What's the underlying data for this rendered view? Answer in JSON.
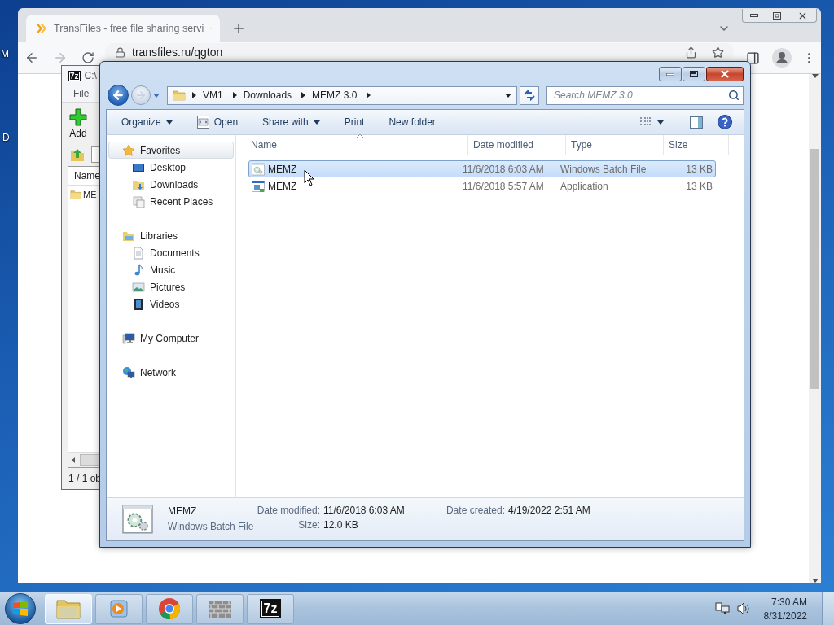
{
  "desktop": {
    "icon_labels": [
      "M",
      "D"
    ]
  },
  "browser": {
    "tab": {
      "title": "TransFiles - free file sharing servi",
      "selected": true
    },
    "address": "transfiles.ru/qgton"
  },
  "archiver": {
    "logo": "7z",
    "title": "C:\\",
    "menu": [
      "File"
    ],
    "toolbar": [
      "Add"
    ],
    "column": "Name",
    "rows": [
      "ME"
    ],
    "status": "1 / 1 ob"
  },
  "explorer": {
    "breadcrumb": [
      "VM1",
      "Downloads",
      "MEMZ 3.0"
    ],
    "search": {
      "placeholder": "Search MEMZ 3.0"
    },
    "toolbar": [
      {
        "label": "Organize",
        "kind": "menu"
      },
      {
        "label": "Open",
        "kind": "icon"
      },
      {
        "label": "Share with",
        "kind": "menu"
      },
      {
        "label": "Print",
        "kind": "plain"
      },
      {
        "label": "New folder",
        "kind": "plain"
      }
    ],
    "nav": [
      {
        "label": "Favorites",
        "kind": "star",
        "selected": true,
        "children": [
          {
            "label": "Desktop",
            "kind": "desktop",
            "selected": false
          },
          {
            "label": "Downloads",
            "kind": "downloads",
            "selected": false
          },
          {
            "label": "Recent Places",
            "kind": "recent",
            "selected": false
          }
        ]
      },
      {
        "label": "Libraries",
        "kind": "libraries",
        "selected": false,
        "children": [
          {
            "label": "Documents",
            "kind": "documents",
            "selected": false
          },
          {
            "label": "Music",
            "kind": "music",
            "selected": false
          },
          {
            "label": "Pictures",
            "kind": "pictures",
            "selected": false
          },
          {
            "label": "Videos",
            "kind": "videos",
            "selected": false
          }
        ]
      },
      {
        "label": "My Computer",
        "kind": "computer",
        "selected": false
      },
      {
        "label": "Network",
        "kind": "network",
        "selected": false
      }
    ],
    "columns": [
      {
        "label": "Name",
        "sorted": true
      },
      {
        "label": "Date modified",
        "sorted": false
      },
      {
        "label": "Type",
        "sorted": false
      },
      {
        "label": "Size",
        "sorted": false
      }
    ],
    "files": [
      {
        "name": "MEMZ",
        "kind": "batch",
        "date": "11/6/2018 6:03 AM",
        "type": "Windows Batch File",
        "size": "13 KB",
        "selected": true
      },
      {
        "name": "MEMZ",
        "kind": "application",
        "date": "11/6/2018 5:57 AM",
        "type": "Application",
        "size": "13 KB",
        "selected": false
      }
    ],
    "details": {
      "name": "MEMZ",
      "kind": "batch",
      "type": "Windows Batch File",
      "fields": [
        {
          "label": "Date modified:",
          "value": "11/6/2018 6:03 AM"
        },
        {
          "label": "Date created:",
          "value": "4/19/2022 2:51 AM"
        },
        {
          "label": "Size:",
          "value": "12.0 KB"
        }
      ]
    }
  },
  "taskbar": {
    "apps": [
      {
        "kind": "explorer",
        "selected": true
      },
      {
        "kind": "media",
        "selected": false
      },
      {
        "kind": "chrome",
        "selected": false
      },
      {
        "kind": "firewall",
        "selected": false
      },
      {
        "kind": "sevenzip",
        "label": "7z",
        "selected": false
      }
    ],
    "clock": {
      "time": "7:30 AM",
      "date": "8/31/2022"
    }
  }
}
